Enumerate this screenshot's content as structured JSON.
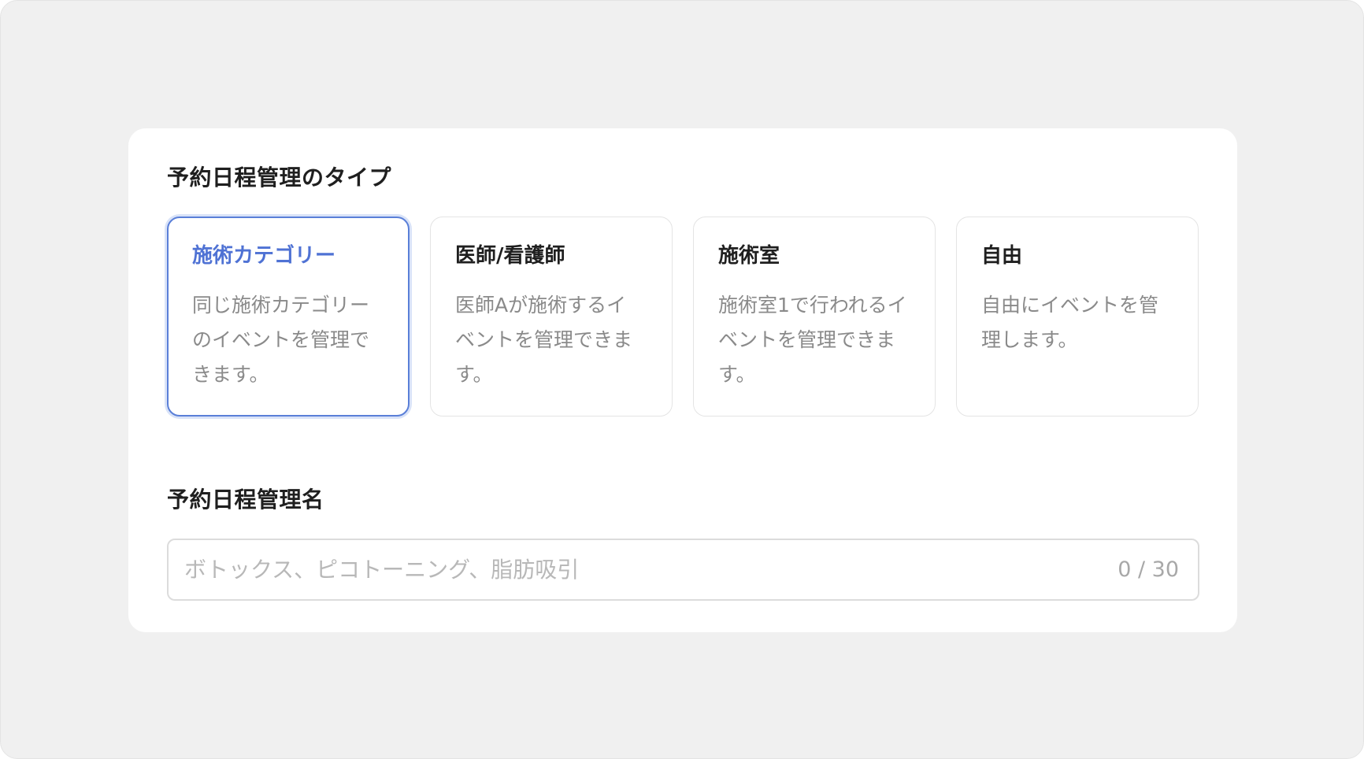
{
  "schedule_type": {
    "title": "予約日程管理のタイプ",
    "options": [
      {
        "label": "施術カテゴリー",
        "description": "同じ施術カテゴリーのイベントを管理できます。",
        "selected": true
      },
      {
        "label": "医師/看護師",
        "description": "医師Aが施術するイベントを管理できます。",
        "selected": false
      },
      {
        "label": "施術室",
        "description": "施術室1で行われるイベントを管理できます。",
        "selected": false
      },
      {
        "label": "自由",
        "description": "自由にイベントを管理します。",
        "selected": false
      }
    ]
  },
  "schedule_name": {
    "title": "予約日程管理名",
    "value": "",
    "placeholder": "ボトックス、ピコトーニング、脂肪吸引",
    "char_count": "0 / 30"
  },
  "colors": {
    "accent": "#4f72d4",
    "selected_border": "#5a7fd8",
    "background": "#f0f0f0",
    "panel": "#ffffff"
  }
}
